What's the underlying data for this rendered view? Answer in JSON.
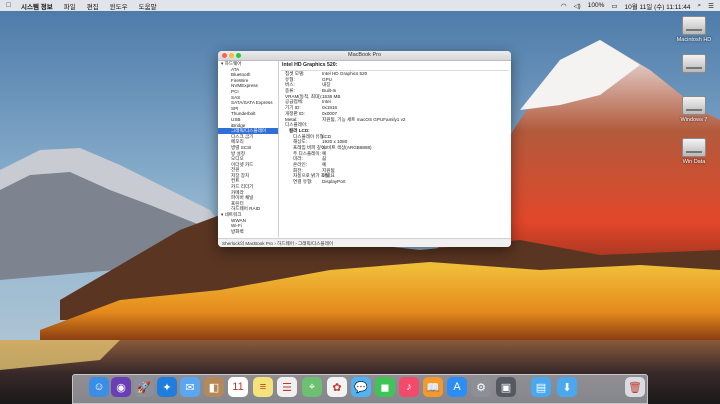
{
  "menubar": {
    "apple_icon": "apple-icon",
    "items": [
      "시스템 정보",
      "파일",
      "편집",
      "윈도우",
      "도움말"
    ],
    "status_right": [
      "100%",
      "10월 11일 (수) 11:11:44"
    ]
  },
  "desktop_icons": [
    {
      "label": "Macintosh HD",
      "name": "desktop-icon-macintosh-hd"
    },
    {
      "label": "",
      "name": "desktop-icon-drive-2"
    },
    {
      "label": "Windows 7",
      "name": "desktop-icon-windows7"
    },
    {
      "label": "Win Data",
      "name": "desktop-icon-win-data"
    }
  ],
  "window": {
    "title": "MacBook Pro",
    "sidebar": [
      {
        "label": "▾ 하드웨어",
        "head": true
      },
      {
        "label": "ATA"
      },
      {
        "label": "Bluetooth"
      },
      {
        "label": "FireWire"
      },
      {
        "label": "NVMExpress"
      },
      {
        "label": "PCI"
      },
      {
        "label": "SAS"
      },
      {
        "label": "SATA/SATA Express"
      },
      {
        "label": "SPI"
      },
      {
        "label": "Thunderbolt"
      },
      {
        "label": "USB"
      },
      {
        "label": "iBridge"
      },
      {
        "label": "그래픽/디스플레이",
        "selected": true
      },
      {
        "label": "디스크 굽기"
      },
      {
        "label": "메모리"
      },
      {
        "label": "병렬 SCSI"
      },
      {
        "label": "방 설정"
      },
      {
        "label": "오디오"
      },
      {
        "label": "이더넷 카드"
      },
      {
        "label": "전원"
      },
      {
        "label": "저장 장치"
      },
      {
        "label": "컨트"
      },
      {
        "label": "카드 리더기"
      },
      {
        "label": "카메라"
      },
      {
        "label": "파이버 채널"
      },
      {
        "label": "프린터"
      },
      {
        "label": "하드웨어 RAID"
      },
      {
        "label": "▾ 네트워크",
        "head": true
      },
      {
        "label": "WWAN"
      },
      {
        "label": "Wi-Fi"
      },
      {
        "label": "방화벽"
      }
    ],
    "detail": {
      "header": "Intel HD Graphics 520:",
      "rows": [
        {
          "k": "칩셋 모델:",
          "v": "Intel HD Graphics 520"
        },
        {
          "k": "유형:",
          "v": "GPU"
        },
        {
          "k": "버스:",
          "v": "내장"
        },
        {
          "k": "종류:",
          "v": "Built-In"
        },
        {
          "k": "VRAM(동적, 최대):",
          "v": "1536 MB"
        },
        {
          "k": "공급업체:",
          "v": "Intel"
        },
        {
          "k": "기기 ID:",
          "v": "0x1916"
        },
        {
          "k": "개정판 ID:",
          "v": "0x0007"
        },
        {
          "k": "Metal:",
          "v": "지원됨, 기능 세트 macOS GPUFamily1 v2"
        },
        {
          "k": "디스플레이:",
          "v": ""
        }
      ],
      "subheader": "컬러 LCD:",
      "subrows": [
        {
          "k": "디스플레이 유형:",
          "v": "LCD"
        },
        {
          "k": "해상도:",
          "v": "1920 x 1080"
        },
        {
          "k": "프레임 버퍼 깊이:",
          "v": "24비트 색상(ARGB8888)"
        },
        {
          "k": "주 디스플레이:",
          "v": "예"
        },
        {
          "k": "미러:",
          "v": "끔"
        },
        {
          "k": "온라인:",
          "v": "예"
        },
        {
          "k": "회전:",
          "v": "지원됨"
        },
        {
          "k": "자동으로 밝기 조절:",
          "v": "아니요"
        },
        {
          "k": "연결 유형:",
          "v": "DisplayPort"
        }
      ]
    },
    "statusbar": "Sherlock의 MacBook Pro › 하드웨어 › 그래픽/디스플레이"
  },
  "dock": {
    "items": [
      {
        "name": "finder-icon",
        "color": "#3a8ee6",
        "glyph": "☺"
      },
      {
        "name": "siri-icon",
        "color": "#6a3fb5",
        "glyph": "◉"
      },
      {
        "name": "launchpad-icon",
        "color": "#8a8f99",
        "glyph": "🚀"
      },
      {
        "name": "safari-icon",
        "color": "#1f7de0",
        "glyph": "✦"
      },
      {
        "name": "mail-icon",
        "color": "#5aa7f0",
        "glyph": "✉"
      },
      {
        "name": "contacts-icon",
        "color": "#b58a5a",
        "glyph": "◧"
      },
      {
        "name": "calendar-icon",
        "color": "#ffffff",
        "glyph": "11"
      },
      {
        "name": "notes-icon",
        "color": "#f4e27a",
        "glyph": "≡"
      },
      {
        "name": "reminders-icon",
        "color": "#f0f0f0",
        "glyph": "☰"
      },
      {
        "name": "maps-icon",
        "color": "#6cc070",
        "glyph": "⌖"
      },
      {
        "name": "photos-icon",
        "color": "#f3f3f3",
        "glyph": "✿"
      },
      {
        "name": "messages-icon",
        "color": "#4fb3f5",
        "glyph": "💬"
      },
      {
        "name": "facetime-icon",
        "color": "#3fc456",
        "glyph": "◼"
      },
      {
        "name": "music-icon",
        "color": "#f24a6b",
        "glyph": "♪"
      },
      {
        "name": "ibooks-icon",
        "color": "#f39a2a",
        "glyph": "📖"
      },
      {
        "name": "app-store-icon",
        "color": "#2c8ef5",
        "glyph": "A"
      },
      {
        "name": "system-preferences-icon",
        "color": "#8c8f96",
        "glyph": "⚙"
      },
      {
        "name": "system-information-icon",
        "color": "#555a62",
        "glyph": "▣"
      },
      {
        "name": "folder-icon",
        "color": "#4aa8ef",
        "glyph": "▤"
      },
      {
        "name": "downloads-folder-icon",
        "color": "#4aa8ef",
        "glyph": "⬇"
      },
      {
        "name": "trash-icon",
        "color": "#d9dde3",
        "glyph": "🗑"
      }
    ]
  }
}
